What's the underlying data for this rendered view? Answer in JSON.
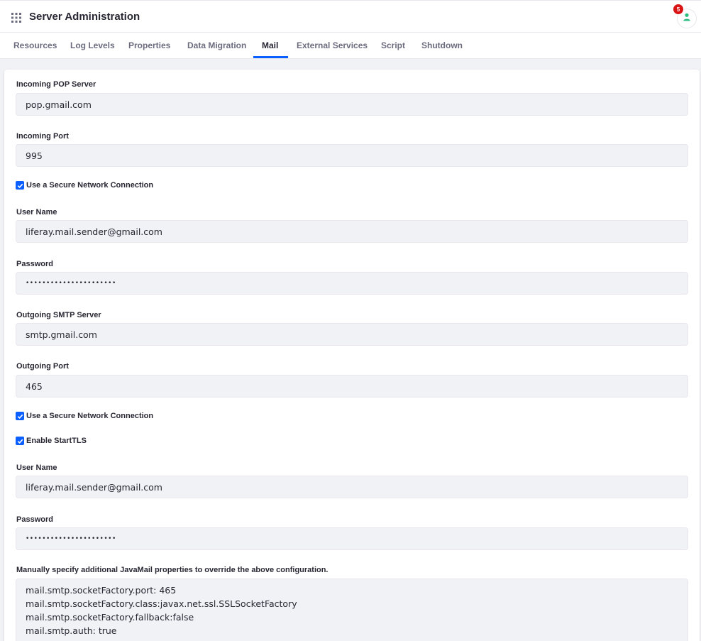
{
  "header": {
    "title": "Server Administration",
    "notification_count": "5",
    "apps_icon": "apps-grid-icon",
    "user_icon": "user-icon",
    "accent_color": "#0b5fff",
    "avatar_color": "#2fbd82",
    "badge_color": "#da1414"
  },
  "tabs": [
    {
      "label": "Resources"
    },
    {
      "label": "Log Levels"
    },
    {
      "label": "Properties"
    },
    {
      "label": "Data Migration"
    },
    {
      "label": "Mail",
      "active": true
    },
    {
      "label": "External Services"
    },
    {
      "label": "Script"
    },
    {
      "label": "Shutdown"
    }
  ],
  "form": {
    "incoming_pop_server": {
      "label": "Incoming POP Server",
      "value": "pop.gmail.com"
    },
    "incoming_port": {
      "label": "Incoming Port",
      "value": "995"
    },
    "pop_secure": {
      "label": "Use a Secure Network Connection",
      "checked": true
    },
    "pop_user_name": {
      "label": "User Name",
      "value": "liferay.mail.sender@gmail.com"
    },
    "pop_password": {
      "label": "Password",
      "value": "••••••••••••••••••••••"
    },
    "outgoing_smtp_server": {
      "label": "Outgoing SMTP Server",
      "value": "smtp.gmail.com"
    },
    "outgoing_port": {
      "label": "Outgoing Port",
      "value": "465"
    },
    "smtp_secure": {
      "label": "Use a Secure Network Connection",
      "checked": true
    },
    "enable_starttls": {
      "label": "Enable StartTLS",
      "checked": true
    },
    "smtp_user_name": {
      "label": "User Name",
      "value": "liferay.mail.sender@gmail.com"
    },
    "smtp_password": {
      "label": "Password",
      "value": "••••••••••••••••••••••"
    },
    "javamail": {
      "label": "Manually specify additional JavaMail properties to override the above configuration.",
      "lines": [
        "mail.smtp.socketFactory.port: 465",
        "mail.smtp.socketFactory.class:javax.net.ssl.SSLSocketFactory",
        "mail.smtp.socketFactory.fallback:false",
        "mail.smtp.auth: true"
      ]
    }
  }
}
